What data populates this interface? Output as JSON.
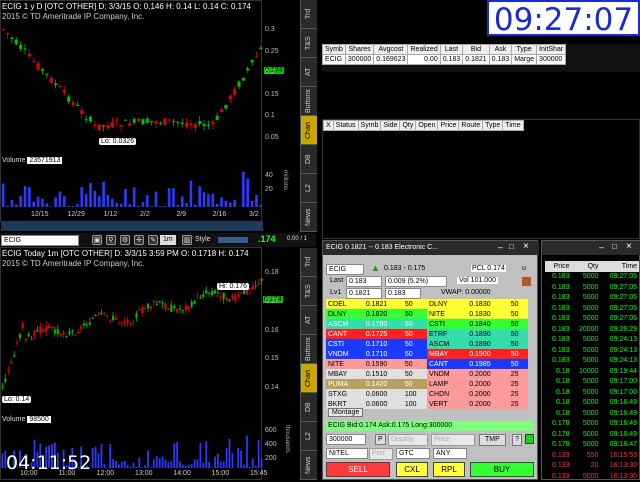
{
  "clock": "09:27:07",
  "timer": "04:11:52",
  "colors": {
    "up": "#00c000",
    "down": "#e00000",
    "volume": "#2a3bff",
    "accent": "#c9a600"
  },
  "chart1": {
    "header": "ECIG 1 y D [OTC OTHER]  D: 3/3/15  O: 0.146  H: 0.14  L: 0.14  C: 0.174",
    "copyright": "2015 © TD Ameritrade IP Company, Inc.",
    "price_ticks": [
      "0.3",
      "0.25",
      "0.2",
      "0.15",
      "0.1",
      "0.05"
    ],
    "last_tag": "0.174",
    "lo_label": "Lo: 0.0326",
    "volume_label": "Volume",
    "volume_value": "23571913",
    "vol_ticks": [
      "40",
      "20"
    ],
    "vol_unit": "millions",
    "x_labels": [
      "12/15",
      "12/29",
      "1/12",
      "2/2",
      "2/9",
      "2/16",
      "3/2"
    ]
  },
  "chart2": {
    "symbol": "ECIG",
    "period": "1m",
    "style_label": "Style",
    "last_value": ".174",
    "ratio": "0.00 / 1",
    "header": "ECIG Today 1m [OTC OTHER]  D: 3/3/15 3:59 PM  O: 0.1718  H: 0.174",
    "copyright": "2015 © TD Ameritrade IP Company, Inc.",
    "price_ticks": [
      "0.18",
      "0.17",
      "0.16",
      "0.15",
      "0.14"
    ],
    "hi_label": "Hi: 0.176",
    "lo_label": "Lo: 0.14",
    "last_tag": "0.174",
    "volume_label": "Volume",
    "volume_value": "98500",
    "vol_ticks": [
      "600",
      "400",
      "200"
    ],
    "vol_unit": "thousands",
    "x_labels": [
      "10:00",
      "11:00",
      "12:00",
      "13:00",
      "14:00",
      "15:00",
      "15:45"
    ]
  },
  "tabs1": [
    "Trd",
    "T&S",
    "AT",
    "Buttons",
    "Chart",
    "DB",
    "L2",
    "News"
  ],
  "tabs2": [
    "Trd",
    "T&S",
    "AT",
    "Buttons",
    "Chart",
    "DB",
    "L2",
    "News"
  ],
  "active_tab": "Chart",
  "positions": {
    "headers": [
      "Symb",
      "Shares",
      "Avgcost",
      "Realized",
      "Last",
      "Bid",
      "Ask",
      "Type",
      "InitShar"
    ],
    "rows": [
      [
        "ECIG",
        "300000",
        "0.169623",
        "0.00",
        "0.183",
        "0.1821",
        "0.183",
        "Marge",
        "300000"
      ]
    ]
  },
  "orders": {
    "headers": [
      "X",
      "Status",
      "Symb",
      "Side",
      "Qty",
      "Open",
      "Price",
      "Route",
      "Type",
      "Time"
    ]
  },
  "level2": {
    "title": "ECIG  0.1821 -- 0.183  Electronic C...",
    "symbol": "ECIG",
    "range": "0.183 - 0.175",
    "pcl": "PCL 0.174",
    "pcl_u": "u",
    "last_label": "Last",
    "last": "0.183",
    "change": "0.009  (5.2%)",
    "vol": "Vol  101.000",
    "lv1_label": "Lv1",
    "lv1_bid": "0.1821",
    "lv1_ask": "0.183",
    "vwap": "VWAP:   0.00000",
    "bids": [
      {
        "mm": "CDEL",
        "price": "0.1821",
        "size": "50",
        "bg": "#ffff33",
        "fg": "#000"
      },
      {
        "mm": "DLNY",
        "price": "0.1820",
        "size": "50",
        "bg": "#33ff33",
        "fg": "#000"
      },
      {
        "mm": "ASCM",
        "price": "0.1780",
        "size": "50",
        "bg": "#33ddaa",
        "fg": "#fff"
      },
      {
        "mm": "CANT",
        "price": "0.1725",
        "size": "50",
        "bg": "#ff2020",
        "fg": "#fff"
      },
      {
        "mm": "CSTI",
        "price": "0.1710",
        "size": "50",
        "bg": "#1a3bff",
        "fg": "#fff"
      },
      {
        "mm": "VNDM",
        "price": "0.1710",
        "size": "50",
        "bg": "#1a3bff",
        "fg": "#fff"
      },
      {
        "mm": "NITE",
        "price": "0.1590",
        "size": "50",
        "bg": "#ff9a9a",
        "fg": "#000"
      },
      {
        "mm": "MBAY",
        "price": "0.1510",
        "size": "50",
        "bg": "#e0e0e0",
        "fg": "#000"
      },
      {
        "mm": "PUMA",
        "price": "0.1420",
        "size": "50",
        "bg": "#b8a060",
        "fg": "#fff"
      },
      {
        "mm": "STXG",
        "price": "0.0600",
        "size": "100",
        "bg": "#e0e0e0",
        "fg": "#000"
      },
      {
        "mm": "BKRT",
        "price": "0.0600",
        "size": "100",
        "bg": "#e0e0e0",
        "fg": "#000"
      }
    ],
    "asks": [
      {
        "mm": "DLNY",
        "price": "0.1830",
        "size": "50",
        "bg": "#ffff33",
        "fg": "#000"
      },
      {
        "mm": "NITE",
        "price": "0.1830",
        "size": "50",
        "bg": "#ffff33",
        "fg": "#000"
      },
      {
        "mm": "CSTI",
        "price": "0.1840",
        "size": "50",
        "bg": "#33ff33",
        "fg": "#000"
      },
      {
        "mm": "ETRF",
        "price": "0.1890",
        "size": "50",
        "bg": "#33ddaa",
        "fg": "#000"
      },
      {
        "mm": "ASCM",
        "price": "0.1890",
        "size": "50",
        "bg": "#33ddaa",
        "fg": "#000"
      },
      {
        "mm": "MBAY",
        "price": "0.1900",
        "size": "50",
        "bg": "#ff2020",
        "fg": "#fff"
      },
      {
        "mm": "CANT",
        "price": "0.1985",
        "size": "50",
        "bg": "#1a3bff",
        "fg": "#fff"
      },
      {
        "mm": "VNDM",
        "price": "0.2000",
        "size": "25",
        "bg": "#ff9a9a",
        "fg": "#000"
      },
      {
        "mm": "LAMP",
        "price": "0.2000",
        "size": "25",
        "bg": "#ff9a9a",
        "fg": "#000"
      },
      {
        "mm": "CHDN",
        "price": "0.2000",
        "size": "25",
        "bg": "#ff9a9a",
        "fg": "#000"
      },
      {
        "mm": "VERT",
        "price": "0.2000",
        "size": "25",
        "bg": "#ff9a9a",
        "fg": "#000"
      }
    ],
    "montage_tab": "Montage",
    "status": "ECIG Bid:0.174 Ask:0.175   Long:300000",
    "qty": "300000",
    "p_btn": "P",
    "display_label": "Display",
    "price_label": "Price",
    "tmp_label": "TMP",
    "help_label": "?",
    "route": "NITEL",
    "pref_label": "Pref",
    "tif": "GTC",
    "cond": "ANY",
    "sell": "SELL",
    "cxl": "CXL",
    "rpl": "RPL",
    "buy": "BUY"
  },
  "ts": {
    "headers": [
      "Price",
      "Qty",
      "Time"
    ],
    "rows": [
      [
        "0.183",
        "5000",
        "09:27:05",
        "#00ff00"
      ],
      [
        "0.183",
        "5000",
        "09:27:05",
        "#00ff00"
      ],
      [
        "0.183",
        "5000",
        "09:27:05",
        "#00ff00"
      ],
      [
        "0.183",
        "5000",
        "09:27:05",
        "#00ff00"
      ],
      [
        "0.183",
        "5000",
        "09:27:05",
        "#00ff00"
      ],
      [
        "0.183",
        "20000",
        "09:26:29",
        "#00ff00"
      ],
      [
        "0.183",
        "5000",
        "09:24:13",
        "#00ff00"
      ],
      [
        "0.183",
        "5000",
        "09:24:13",
        "#00ff00"
      ],
      [
        "0.183",
        "5000",
        "09:24:13",
        "#00ff00"
      ],
      [
        "0.18",
        "10000",
        "09:19:44",
        "#00ff00"
      ],
      [
        "0.18",
        "5000",
        "09:17:00",
        "#00ff00"
      ],
      [
        "0.18",
        "5000",
        "09:17:00",
        "#00ff00"
      ],
      [
        "0.18",
        "5000",
        "09:16:49",
        "#00ff00"
      ],
      [
        "0.18",
        "5000",
        "09:16:49",
        "#00ff00"
      ],
      [
        "0.178",
        "5000",
        "09:16:49",
        "#00ff00"
      ],
      [
        "0.178",
        "5000",
        "09:16:49",
        "#00ff00"
      ],
      [
        "0.178",
        "5000",
        "09:16:47",
        "#00ff00"
      ],
      [
        "0.133",
        "550",
        "16:15:53",
        "#ff3030"
      ],
      [
        "0.133",
        "20",
        "16:13:30",
        "#ff3030"
      ],
      [
        "0.133",
        "5000",
        "16:13:30",
        "#ff3030"
      ]
    ]
  }
}
